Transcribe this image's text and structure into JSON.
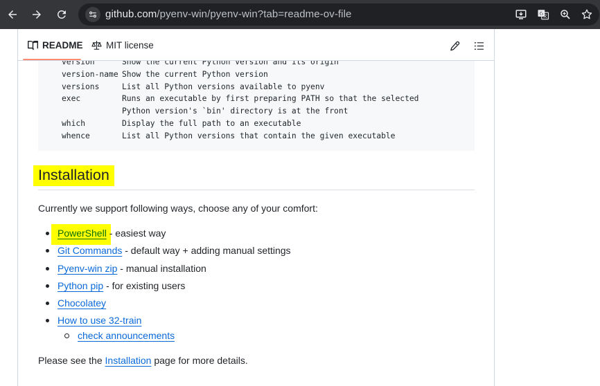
{
  "browser": {
    "url_host": "github.com",
    "url_path": "/pyenv-win/pyenv-win?tab=readme-ov-file",
    "icons": [
      "back-arrow-icon",
      "forward-arrow-icon",
      "reload-icon",
      "site-info-icon",
      "install-app-icon",
      "translate-icon",
      "zoom-icon",
      "bookmark-star-icon"
    ]
  },
  "tabs": {
    "readme": "README",
    "license": "MIT license"
  },
  "code_lines": [
    {
      "cmd": "version",
      "desc": "Show the current Python version and its origin"
    },
    {
      "cmd": "version-name",
      "desc": "Show the current Python version"
    },
    {
      "cmd": "versions",
      "desc": "List all Python versions available to pyenv"
    },
    {
      "cmd": "exec",
      "desc": "Runs an executable by first preparing PATH so that the selected"
    },
    {
      "cmd": "",
      "desc": "Python version's `bin' directory is at the front"
    },
    {
      "cmd": "which",
      "desc": "Display the full path to an executable"
    },
    {
      "cmd": "whence",
      "desc": "List all Python versions that contain the given executable"
    }
  ],
  "installation": {
    "heading": "Installation",
    "intro": "Currently we support following ways, choose any of your comfort:",
    "items": [
      {
        "link": "PowerShell",
        "rest": " - easiest way"
      },
      {
        "link": "Git Commands",
        "rest": " - default way + adding manual settings"
      },
      {
        "link": "Pyenv-win zip",
        "rest": " - manual installation"
      },
      {
        "link": "Python pip",
        "rest": " - for existing users"
      },
      {
        "link": "Chocolatey",
        "rest": ""
      },
      {
        "link": "How to use 32-train",
        "rest": ""
      }
    ],
    "subitem": "check announcements",
    "outro_before": "Please see the ",
    "outro_link": "Installation",
    "outro_after": " page for more details."
  },
  "colors": {
    "highlight": "#ffff00",
    "link": "#0969da",
    "tab_underline": "#fd8c73"
  }
}
